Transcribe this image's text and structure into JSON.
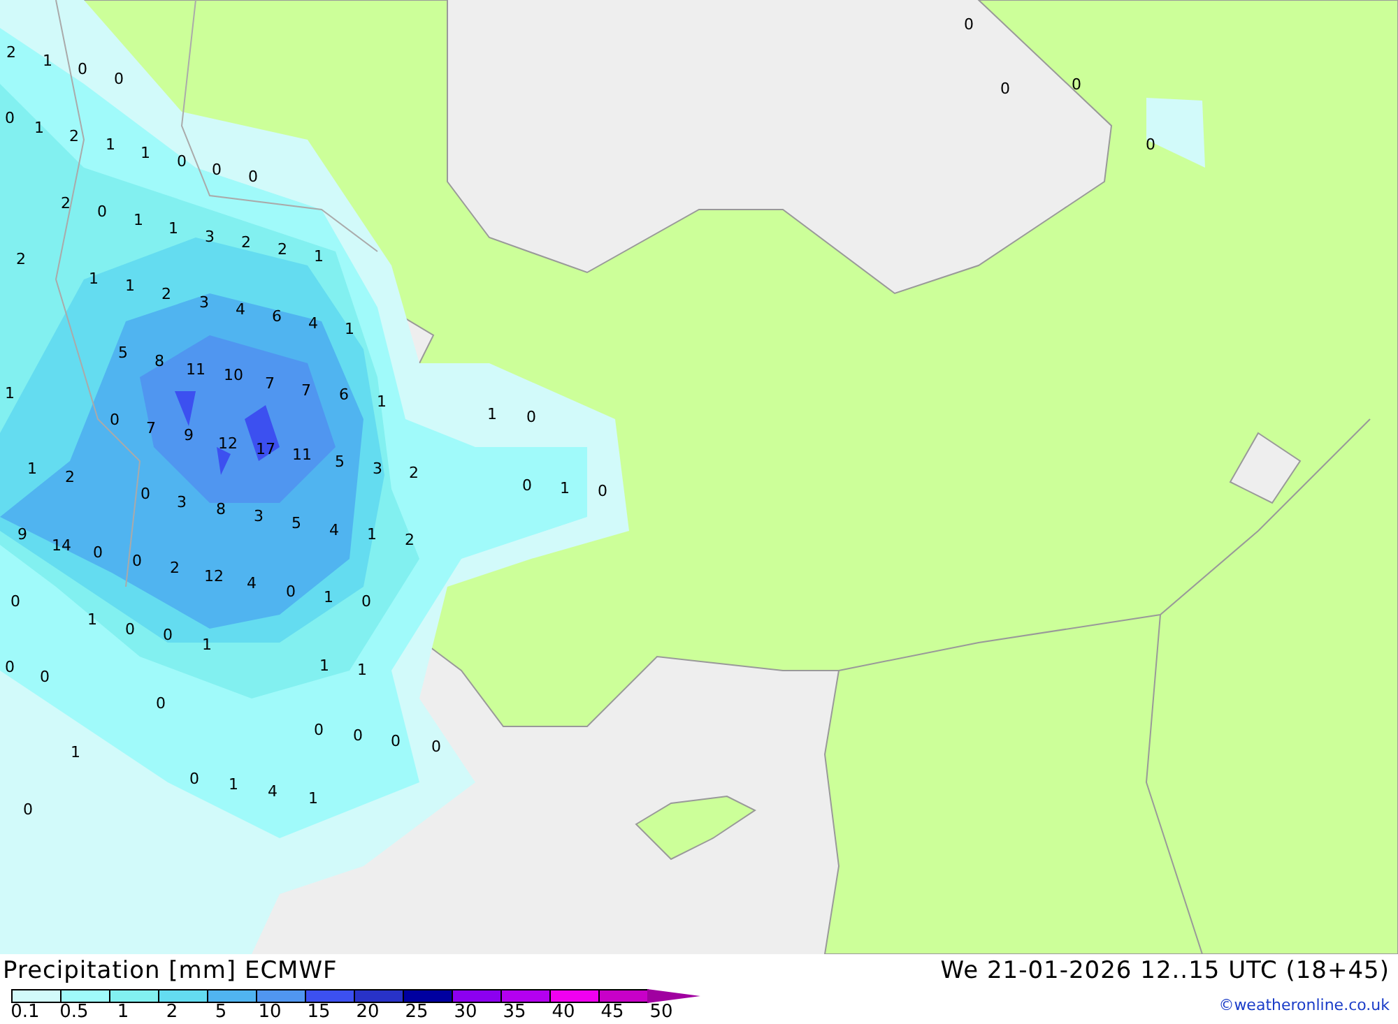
{
  "map": {
    "labels": [
      "2",
      "1",
      "0",
      "0",
      "0",
      "1",
      "2",
      "1",
      "1",
      "0",
      "0",
      "0",
      "2",
      "0",
      "1",
      "1",
      "3",
      "2",
      "2",
      "2",
      "1",
      "1",
      "1",
      "2",
      "3",
      "4",
      "6",
      "4",
      "1",
      "1",
      "5",
      "8",
      "11",
      "10",
      "7",
      "7",
      "6",
      "1",
      "0",
      "7",
      "9",
      "12",
      "17",
      "1",
      "2",
      "11",
      "5",
      "3",
      "2",
      "1",
      "0",
      "0",
      "3",
      "8",
      "3",
      "9",
      "14",
      "0",
      "0",
      "5",
      "4",
      "1",
      "2",
      "0",
      "1",
      "0",
      "2",
      "12",
      "4",
      "0",
      "0",
      "1",
      "0",
      "1",
      "0",
      "0",
      "1",
      "0",
      "0",
      "1",
      "1",
      "0",
      "1",
      "0",
      "0",
      "0",
      "0",
      "0",
      "1",
      "0",
      "4",
      "1",
      "0",
      "0",
      "0",
      "0"
    ]
  },
  "footer": {
    "title": "Precipitation [mm] ECMWF",
    "datetime": "We 21-01-2026 12..15 UTC (18+45)",
    "credit": "©weatheronline.co.uk"
  },
  "legend": {
    "colors": [
      {
        "color": "#d2fafa"
      },
      {
        "color": "#a0fafa"
      },
      {
        "color": "#82f0f0"
      },
      {
        "color": "#64dcf0"
      },
      {
        "color": "#50b4f0"
      },
      {
        "color": "#5096f0"
      },
      {
        "color": "#3c50f0"
      },
      {
        "color": "#2832c8"
      },
      {
        "color": "#0000a0"
      },
      {
        "color": "#8c00f0"
      },
      {
        "color": "#b400f0"
      },
      {
        "color": "#f000f0"
      },
      {
        "color": "#c800c8"
      }
    ],
    "ticks": [
      "0.1",
      "0.5",
      "1",
      "2",
      "5",
      "10",
      "15",
      "20",
      "25",
      "30",
      "35",
      "40",
      "45",
      "50"
    ]
  }
}
